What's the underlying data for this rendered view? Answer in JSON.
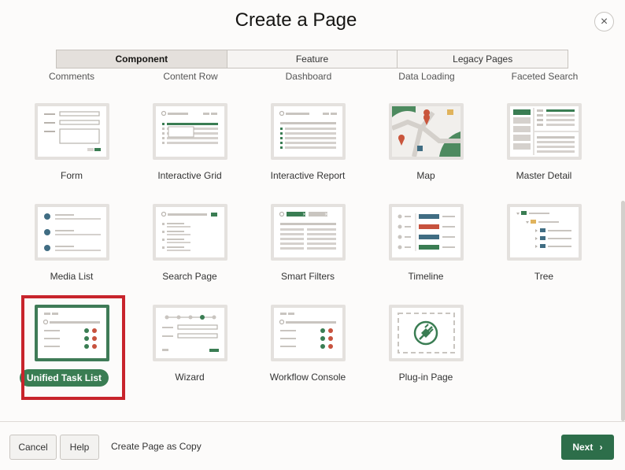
{
  "dialog": {
    "title": "Create a Page",
    "close_icon": "×"
  },
  "tabs": [
    {
      "label": "Component",
      "active": true
    },
    {
      "label": "Feature",
      "active": false
    },
    {
      "label": "Legacy Pages",
      "active": false
    }
  ],
  "cut_row_labels": [
    "Comments",
    "Content Row",
    "Dashboard",
    "Data Loading",
    "Faceted Search"
  ],
  "tiles": [
    {
      "label": "Form",
      "icon": "form-thumbnail-icon"
    },
    {
      "label": "Interactive Grid",
      "icon": "interactive-grid-thumbnail-icon"
    },
    {
      "label": "Interactive Report",
      "icon": "interactive-report-thumbnail-icon"
    },
    {
      "label": "Map",
      "icon": "map-thumbnail-icon"
    },
    {
      "label": "Master Detail",
      "icon": "master-detail-thumbnail-icon"
    },
    {
      "label": "Media List",
      "icon": "media-list-thumbnail-icon"
    },
    {
      "label": "Search Page",
      "icon": "search-page-thumbnail-icon"
    },
    {
      "label": "Smart Filters",
      "icon": "smart-filters-thumbnail-icon"
    },
    {
      "label": "Timeline",
      "icon": "timeline-thumbnail-icon"
    },
    {
      "label": "Tree",
      "icon": "tree-thumbnail-icon"
    },
    {
      "label": "Unified Task List",
      "icon": "unified-task-list-thumbnail-icon",
      "selected": true
    },
    {
      "label": "Wizard",
      "icon": "wizard-thumbnail-icon"
    },
    {
      "label": "Workflow Console",
      "icon": "workflow-console-thumbnail-icon"
    },
    {
      "label": "Plug-in Page",
      "icon": "plug-in-thumbnail-icon"
    }
  ],
  "colors": {
    "accent_green": "#3a7d53",
    "selection_red": "#c8242c",
    "map_marker": "#c9553c",
    "timeline_blue": "#406d83",
    "timeline_red": "#c7523e"
  },
  "footer": {
    "cancel_label": "Cancel",
    "help_label": "Help",
    "copy_label": "Create Page as Copy",
    "next_label": "Next",
    "next_icon": "›"
  }
}
